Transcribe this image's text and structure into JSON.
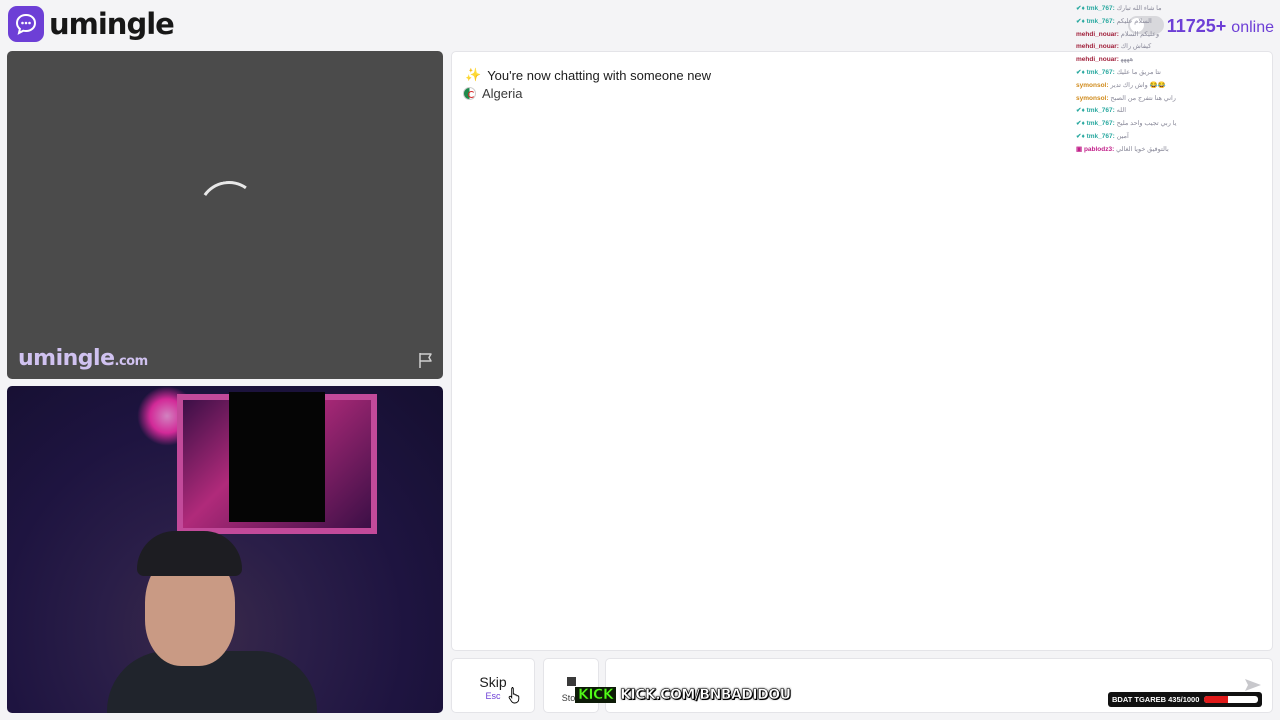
{
  "header": {
    "brand": "umingle",
    "online_count": "11725+",
    "online_label": "online"
  },
  "stranger_video": {
    "watermark_brand": "umingle",
    "watermark_domain": ".com"
  },
  "chat": {
    "system_message": "You're now chatting with someone new",
    "country": "Algeria"
  },
  "stream_chat": [
    {
      "nick": "✔♦ tmk_767:",
      "msg": "ﻣﺎ ﺷﺎﺀ ﺍﻟﻠﻪ ﺗﺒﺎﺭﻙ",
      "color": "#2aa9a0"
    },
    {
      "nick": "✔♦ tmk_767:",
      "msg": "ﺍﻟﺴﻼﻡ ﻋﻠﻴﻜﻢ",
      "color": "#2aa9a0"
    },
    {
      "nick": "mehdi_nouar:",
      "msg": "ﻭﻋﻠﻴﻜﻢ ﺍﻟﺴﻼﻡ",
      "color": "#a01f3a"
    },
    {
      "nick": "mehdi_nouar:",
      "msg": "ﻛﻴﻔﺎﺵ ﺭﺍﻙ",
      "color": "#a01f3a"
    },
    {
      "nick": "mehdi_nouar:",
      "msg": "ﻫﻬﻬﻬ",
      "color": "#a01f3a"
    },
    {
      "nick": "✔♦ tmk_767:",
      "msg": "ﻧﺘﺎ ﻣﺮﻳﻖ ﻣﺎ ﻋﻠﻴﻚ",
      "color": "#2aa9a0"
    },
    {
      "nick": "symonsol:",
      "msg": "ﻭﺍﺵ ﺭﺍﻙ ﺗﺪﻳﺮ 😂😂",
      "color": "#d08a1a"
    },
    {
      "nick": "symonsol:",
      "msg": "ﺭﺍﻧﻲ ﻫﻨﺎ ﻧﺘﻔﺮﺝ ﻣﻦ ﺍﻟﺼﺒﺢ",
      "color": "#d08a1a"
    },
    {
      "nick": "✔♦ tmk_767:",
      "msg": "ﺍﻟﻠﻪ",
      "color": "#2aa9a0"
    },
    {
      "nick": "✔♦ tmk_767:",
      "msg": "ﻳﺎ ﺭﺑﻲ ﺗﺠﻴﺐ ﻭﺍﺣﺪ ﻣﻠﻴﺢ",
      "color": "#2aa9a0"
    },
    {
      "nick": "✔♦ tmk_767:",
      "msg": "ﺁﻣﻴﻦ",
      "color": "#2aa9a0"
    },
    {
      "nick": "▣ pablodz3:",
      "msg": "ﺑﺎﻟﺘﻮﻓﻴﻖ ﺧﻮﻳﺎ ﺍﻟﻐﺎﻟﻲ",
      "color": "#c2208a"
    }
  ],
  "controls": {
    "skip_label": "Skip",
    "skip_hint": "Esc",
    "stop_label": "Stop",
    "message_placeholder": ""
  },
  "overlay": {
    "kick_logo": "KICK",
    "kick_url": "KICK.COM/BNBADIDOU",
    "goal_text": "BDAT TGAREB 435/1000",
    "goal_progress": 0.435
  },
  "colors": {
    "accent": "#6d3fd6",
    "video_bg": "#4b4b4b",
    "kick_green": "#53fc18",
    "goal_red": "#e11a1a"
  }
}
